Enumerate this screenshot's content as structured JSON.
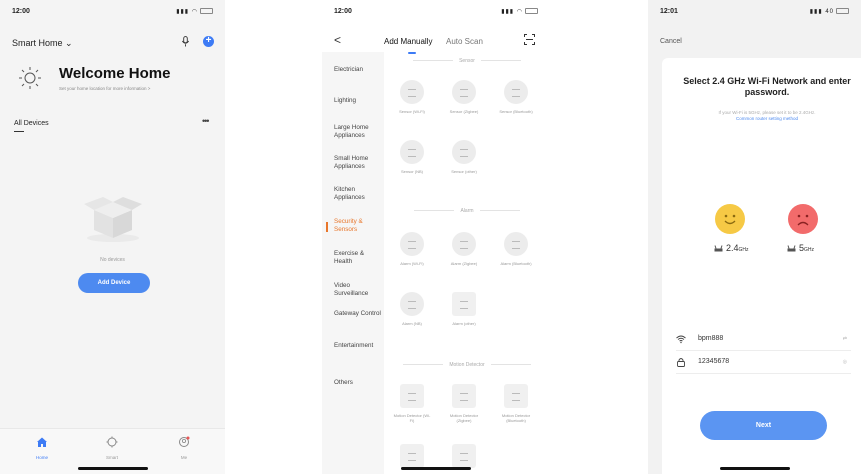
{
  "status": {
    "time_1": "12:00",
    "time_2": "12:00",
    "time_3": "12:01",
    "sig_3": "40"
  },
  "home": {
    "title": "Smart Home",
    "welcome": "Welcome Home",
    "welcome_sub": "Set your home location for more information >",
    "all_devices": "All Devices",
    "more": "•••",
    "no_devices": "No devices",
    "add_device": "Add Device",
    "tabs": [
      {
        "label": "Home",
        "icon": "home-icon"
      },
      {
        "label": "Smart",
        "icon": "smart-icon"
      },
      {
        "label": "Me",
        "icon": "me-icon"
      }
    ],
    "accent": "#4d8af0"
  },
  "add": {
    "back": "<",
    "tab_manual": "Add Manually",
    "tab_scan": "Auto Scan",
    "categories": [
      "Electrician",
      "Lighting",
      "Large Home Appliances",
      "Small Home Appliances",
      "Kitchen Appliances",
      "Security & Sensors",
      "Exercise & Health",
      "Video Surveillance",
      "Gateway Control",
      "Entertainment",
      "Others"
    ],
    "active_category": "Security & Sensors",
    "active_color": "#e8762b",
    "sections": [
      "Sensor",
      "Alarm",
      "Motion Detector"
    ],
    "sensor_devices": [
      "Sensor (Wi-Fi)",
      "Sensor (Zigbee)",
      "Sensor (Bluetooth)",
      "Sensor (NB)",
      "Sensor (other)"
    ],
    "alarm_devices": [
      "Alarm (Wi-Fi)",
      "Alarm (Zigbee)",
      "Alarm (Bluetooth)",
      "Alarm (NB)",
      "Alarm (other)"
    ],
    "motion_devices": [
      "Motion Detector (Wi-Fi)",
      "Motion Detector (Zigbee)",
      "Motion Detector (Bluetooth)"
    ]
  },
  "wifi": {
    "cancel": "Cancel",
    "title": "Select 2.4 GHz Wi-Fi Network and enter password.",
    "sub": "If your Wi-Fi is 5GHz, please set it to be 2.4GHz.",
    "sub_link": "Common router setting method",
    "band_24": "2.4",
    "band_5": "5",
    "band_unit": "GHz",
    "ssid": "bpm888",
    "password": "12345678",
    "next": "Next",
    "button_color": "#5b95f2"
  }
}
